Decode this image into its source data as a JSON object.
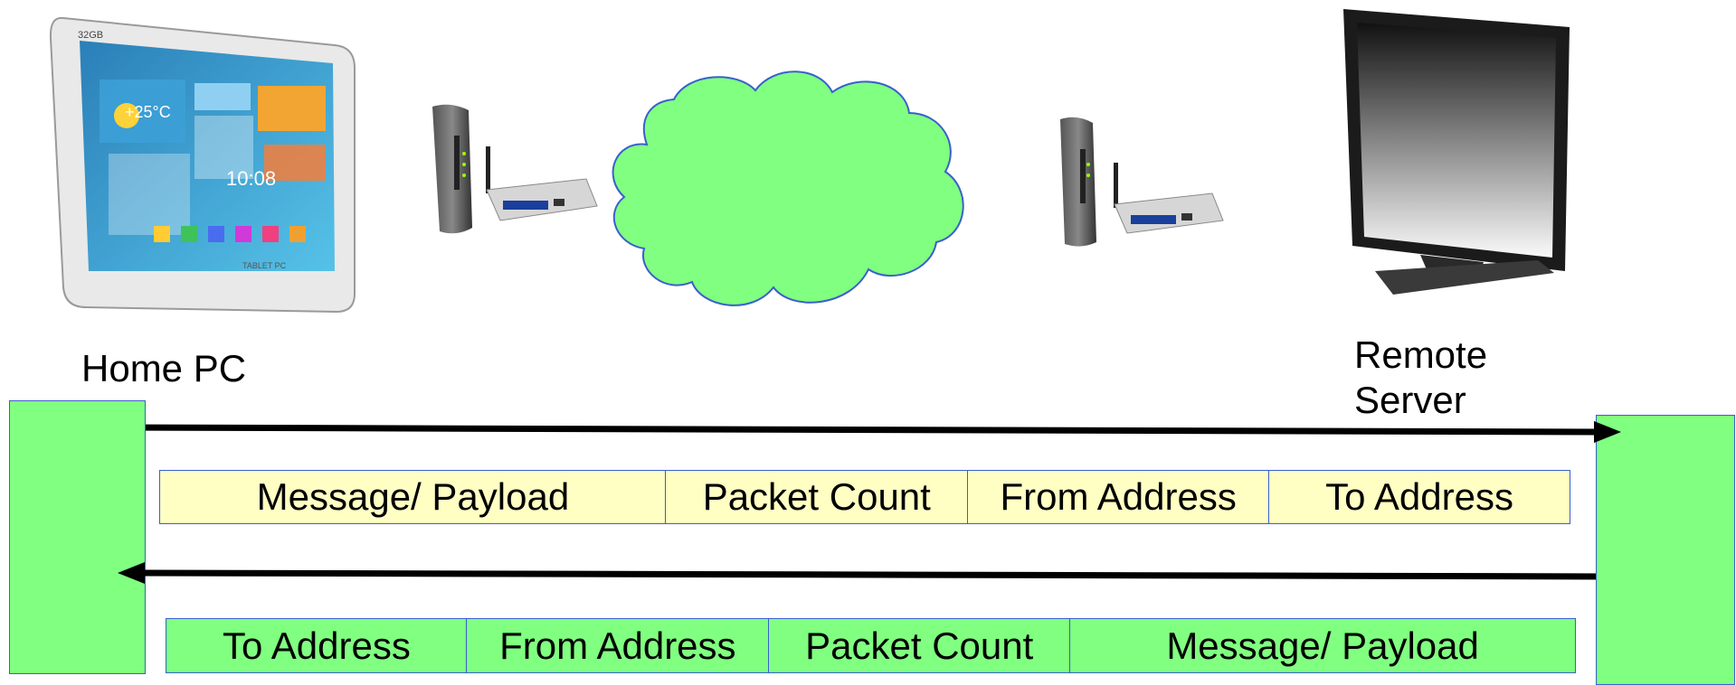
{
  "home": {
    "label": "Home PC"
  },
  "server": {
    "label_line1": "Remote",
    "label_line2": "Server"
  },
  "request_packet": {
    "fields": [
      "Message/ Payload",
      "Packet Count",
      "From Address",
      "To Address"
    ]
  },
  "response_packet": {
    "fields": [
      "To Address",
      "From Address",
      "Packet Count",
      "Message/ Payload"
    ]
  },
  "tablet": {
    "storage_label": "32GB",
    "temp_text": "+25°C",
    "clock_text": "10:08",
    "brand_text": "TABLET PC"
  },
  "icons": [
    "tablet-pc-icon",
    "modem-router-left-icon",
    "internet-cloud-icon",
    "modem-router-right-icon",
    "monitor-icon"
  ],
  "colors": {
    "green": "#80ff80",
    "yellow": "#ffffc4",
    "border": "#3a5fcd",
    "arrow": "#000000"
  }
}
